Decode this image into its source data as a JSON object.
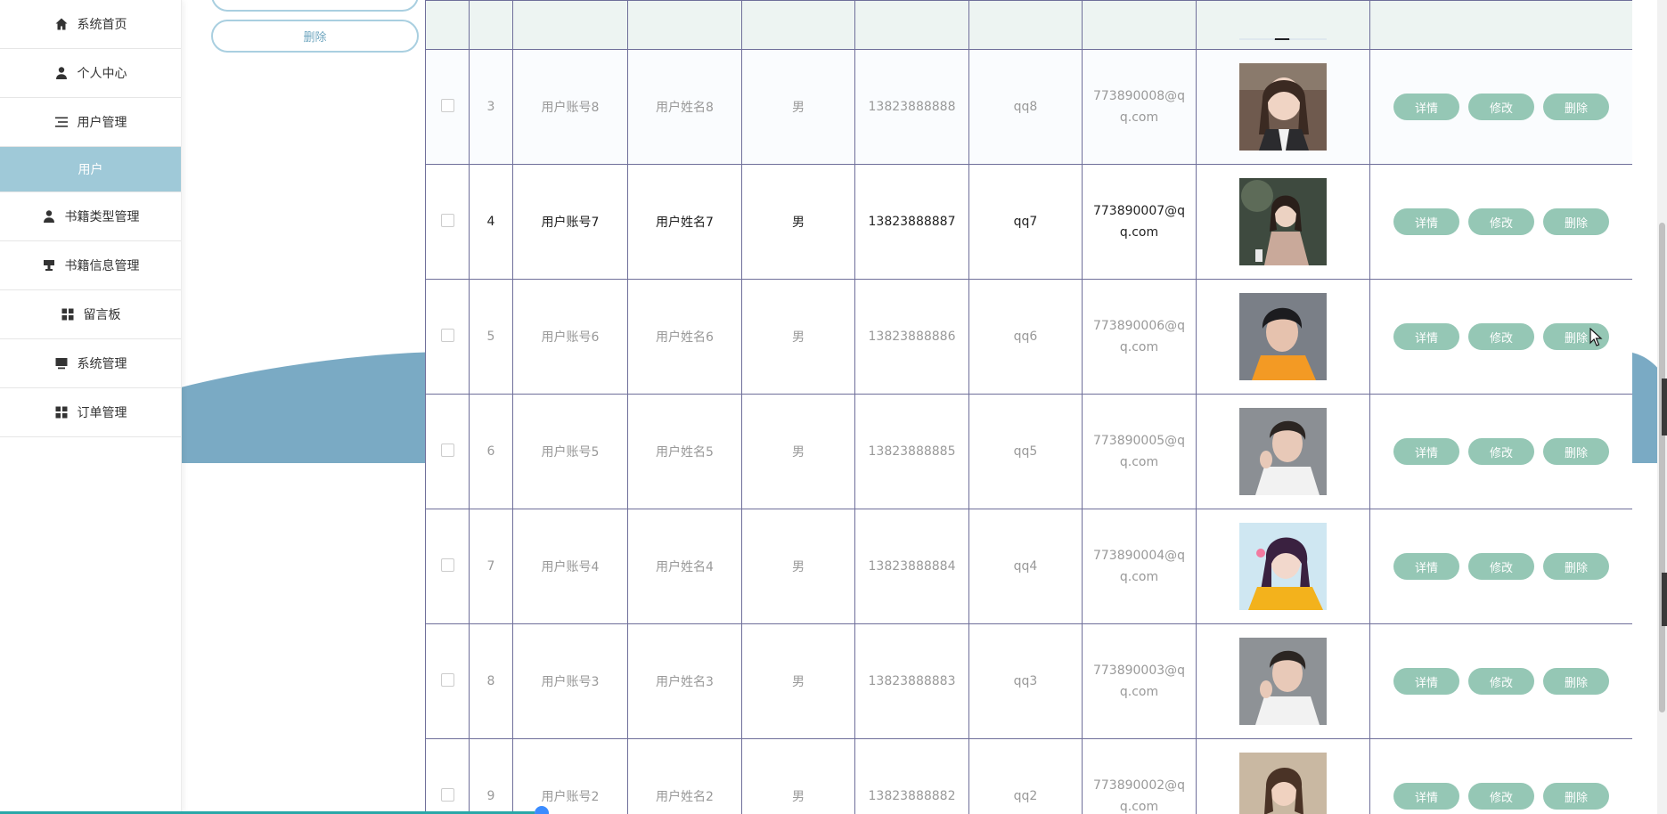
{
  "sidebar": {
    "items": [
      {
        "label": "系统首页",
        "icon": "home-icon"
      },
      {
        "label": "个人中心",
        "icon": "person-icon"
      },
      {
        "label": "用户管理",
        "icon": "list-icon"
      },
      {
        "label": "用户",
        "icon": ""
      },
      {
        "label": "书籍类型管理",
        "icon": "person-icon"
      },
      {
        "label": "书籍信息管理",
        "icon": "stamp-icon"
      },
      {
        "label": "留言板",
        "icon": "grid-icon"
      },
      {
        "label": "系统管理",
        "icon": "monitor-icon"
      },
      {
        "label": "订单管理",
        "icon": "grid-icon"
      }
    ]
  },
  "top_actions": {
    "delete_label": "删除"
  },
  "table": {
    "rows": [
      {
        "index": "3",
        "account": "用户账号8",
        "name": "用户姓名8",
        "gender": "男",
        "phone": "13823888888",
        "qq": "qq8",
        "email": "773890008@qq.com"
      },
      {
        "index": "4",
        "account": "用户账号7",
        "name": "用户姓名7",
        "gender": "男",
        "phone": "13823888887",
        "qq": "qq7",
        "email": "773890007@qq.com"
      },
      {
        "index": "5",
        "account": "用户账号6",
        "name": "用户姓名6",
        "gender": "男",
        "phone": "13823888886",
        "qq": "qq6",
        "email": "773890006@qq.com"
      },
      {
        "index": "6",
        "account": "用户账号5",
        "name": "用户姓名5",
        "gender": "男",
        "phone": "13823888885",
        "qq": "qq5",
        "email": "773890005@qq.com"
      },
      {
        "index": "7",
        "account": "用户账号4",
        "name": "用户姓名4",
        "gender": "男",
        "phone": "13823888884",
        "qq": "qq4",
        "email": "773890004@qq.com"
      },
      {
        "index": "8",
        "account": "用户账号3",
        "name": "用户姓名3",
        "gender": "男",
        "phone": "13823888883",
        "qq": "qq3",
        "email": "773890003@qq.com"
      },
      {
        "index": "9",
        "account": "用户账号2",
        "name": "用户姓名2",
        "gender": "男",
        "phone": "13823888882",
        "qq": "qq2",
        "email": "773890002@qq.com"
      }
    ],
    "actions": {
      "detail": "详情",
      "edit": "修改",
      "delete": "删除"
    }
  },
  "colors": {
    "accent": "#9fc9d8",
    "button_green": "#95c7b5",
    "grid": "#6f6f9a",
    "wave": "#7aaac4"
  }
}
